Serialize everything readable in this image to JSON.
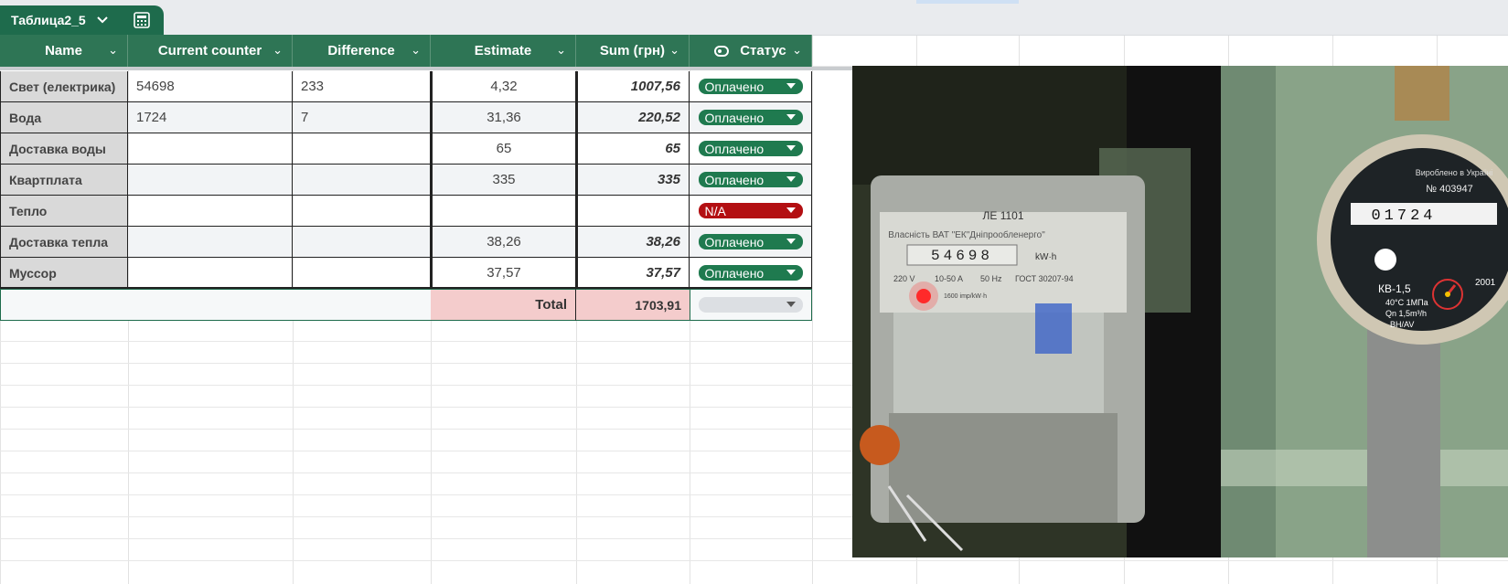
{
  "sheet_tab": {
    "name": "Таблица2_5"
  },
  "columns": [
    {
      "label": "Name"
    },
    {
      "label": "Current counter"
    },
    {
      "label": "Difference"
    },
    {
      "label": "Estimate"
    },
    {
      "label": "Sum (грн)"
    },
    {
      "label": "Статус"
    }
  ],
  "rows": [
    {
      "name": "Свет (електрика)",
      "counter": "54698",
      "difference": "233",
      "estimate": "4,32",
      "sum": "1007,56",
      "status": "Оплачено",
      "status_color": "#1f7a4f"
    },
    {
      "name": "Вода",
      "counter": "1724",
      "difference": "7",
      "estimate": "31,36",
      "sum": "220,52",
      "status": "Оплачено",
      "status_color": "#1f7a4f"
    },
    {
      "name": "Доставка воды",
      "counter": "",
      "difference": "",
      "estimate": "65",
      "sum": "65",
      "status": "Оплачено",
      "status_color": "#1f7a4f"
    },
    {
      "name": "Квартплата",
      "counter": "",
      "difference": "",
      "estimate": "335",
      "sum": "335",
      "status": "Оплачено",
      "status_color": "#1f7a4f"
    },
    {
      "name": "Тепло",
      "counter": "",
      "difference": "",
      "estimate": "",
      "sum": "",
      "status": "N/A",
      "status_color": "#b30f12"
    },
    {
      "name": "Доставка тепла",
      "counter": "",
      "difference": "",
      "estimate": "38,26",
      "sum": "38,26",
      "status": "Оплачено",
      "status_color": "#1f7a4f"
    },
    {
      "name": "Муссор",
      "counter": "",
      "difference": "",
      "estimate": "37,57",
      "sum": "37,57",
      "status": "Оплачено",
      "status_color": "#1f7a4f"
    }
  ],
  "total": {
    "label": "Total",
    "sum": "1703,91"
  },
  "photos": {
    "meter_elec": {
      "model": "ЛЕ 1101",
      "owner": "Власність ВАТ \"ЕК\"Дніпрообленерго\"",
      "reading": "54698",
      "unit": "kW·h",
      "voltage": "220 V",
      "current": "10-50 A",
      "freq": "50 Hz",
      "standard": "ГОСТ 30207-94",
      "imp": "1600 imp/kW·h"
    },
    "meter_water": {
      "made_in": "Вироблено в Україні",
      "serial": "№ 403947",
      "reading": "01724",
      "model": "КВ-1,5",
      "year": "2001",
      "spec1": "40°C 1МПа",
      "spec2": "Qn 1,5m³/h",
      "spec3": "BH/AV"
    }
  },
  "colors": {
    "header_bg": "#2e7555",
    "tab_bg": "#1e6b4c",
    "paid": "#1f7a4f",
    "na": "#b30f12",
    "total_bg": "#f4cccc"
  }
}
